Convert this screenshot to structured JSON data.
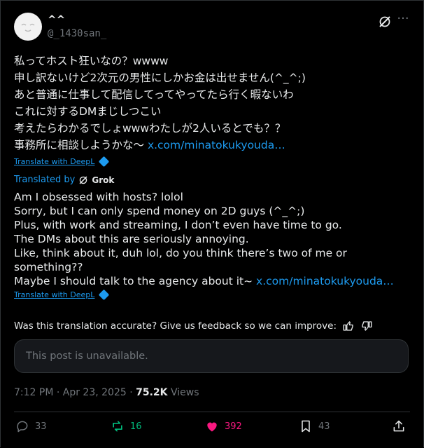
{
  "user": {
    "display_name": "^^",
    "handle": "@_1430san_"
  },
  "post": {
    "lines": [
      "私ってホスト狂いなの？wwww",
      "申し訳ないけど2次元の男性にしかお金は出せません(^_^;)",
      "あと普通に仕事して配信してってやってたら行く暇ないわ",
      "これに対するDMまじしつこい",
      "考えたらわかるでしょwwwわたしが2人いるとでも？？",
      "事務所に相談しようかな〜 "
    ],
    "link": "x.com/minatokukyouda…",
    "translate_label": "Translate with DeepL"
  },
  "translation": {
    "translated_by": "Translated by",
    "grok_label": "Grok",
    "lines": [
      "Am I obsessed with hosts? lolol",
      "Sorry, but I can only spend money on 2D guys (^_^;)",
      "Plus, with work and streaming, I don’t even have time to go.",
      "The DMs about this are seriously annoying.",
      "Like, think about it, duh lol, do you think there’s two of me or",
      "something??",
      "Maybe I should talk to the agency about it~ "
    ],
    "link": "x.com/minatokukyouda…",
    "translate_label": "Translate with DeepL",
    "feedback_text": "Was this translation accurate? Give us feedback so we can improve:"
  },
  "quoted": {
    "unavailable_text": "This post is unavailable."
  },
  "meta": {
    "time": "7:12 PM · Apr 23, 2025 · ",
    "views_count": "75.2K",
    "views_label": " Views"
  },
  "actions": {
    "replies": "33",
    "reposts": "16",
    "likes": "392",
    "bookmarks": "43"
  },
  "colors": {
    "accent": "#1d9bf0",
    "repost": "#00ba7c",
    "like": "#f91880",
    "muted": "#71767b"
  }
}
